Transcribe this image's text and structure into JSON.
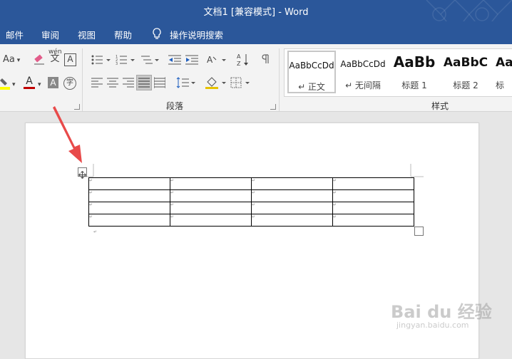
{
  "window": {
    "title": "文档1 [兼容模式]  -  Word"
  },
  "menu": {
    "items": [
      "邮件",
      "审阅",
      "视图",
      "帮助"
    ],
    "tell_me": "操作说明搜索"
  },
  "ribbon": {
    "font_group": {
      "aa_label": "Aa",
      "pinyin_label": "wén"
    },
    "paragraph_group": {
      "label": "段落"
    },
    "styles_group": {
      "label": "样式",
      "tiles": [
        {
          "sample": "AaBbCcDd",
          "name": "↵ 正文"
        },
        {
          "sample": "AaBbCcDd",
          "name": "↵ 无间隔"
        },
        {
          "sample": "AaBb",
          "name": "标题 1"
        },
        {
          "sample": "AaBbC",
          "name": "标题 2"
        },
        {
          "sample": "Aa",
          "name": "标"
        }
      ]
    }
  },
  "document": {
    "table": {
      "rows": 4,
      "cols": 4,
      "cell_mark": "↵"
    },
    "para_mark": "↵"
  },
  "watermark": {
    "text": "Bai du 经验",
    "sub": "jingyan.baidu.com"
  },
  "colors": {
    "accent": "#2b579a",
    "arrow": "#e84a4a",
    "highlight": "#ffff00",
    "font_color": "#c00000"
  }
}
